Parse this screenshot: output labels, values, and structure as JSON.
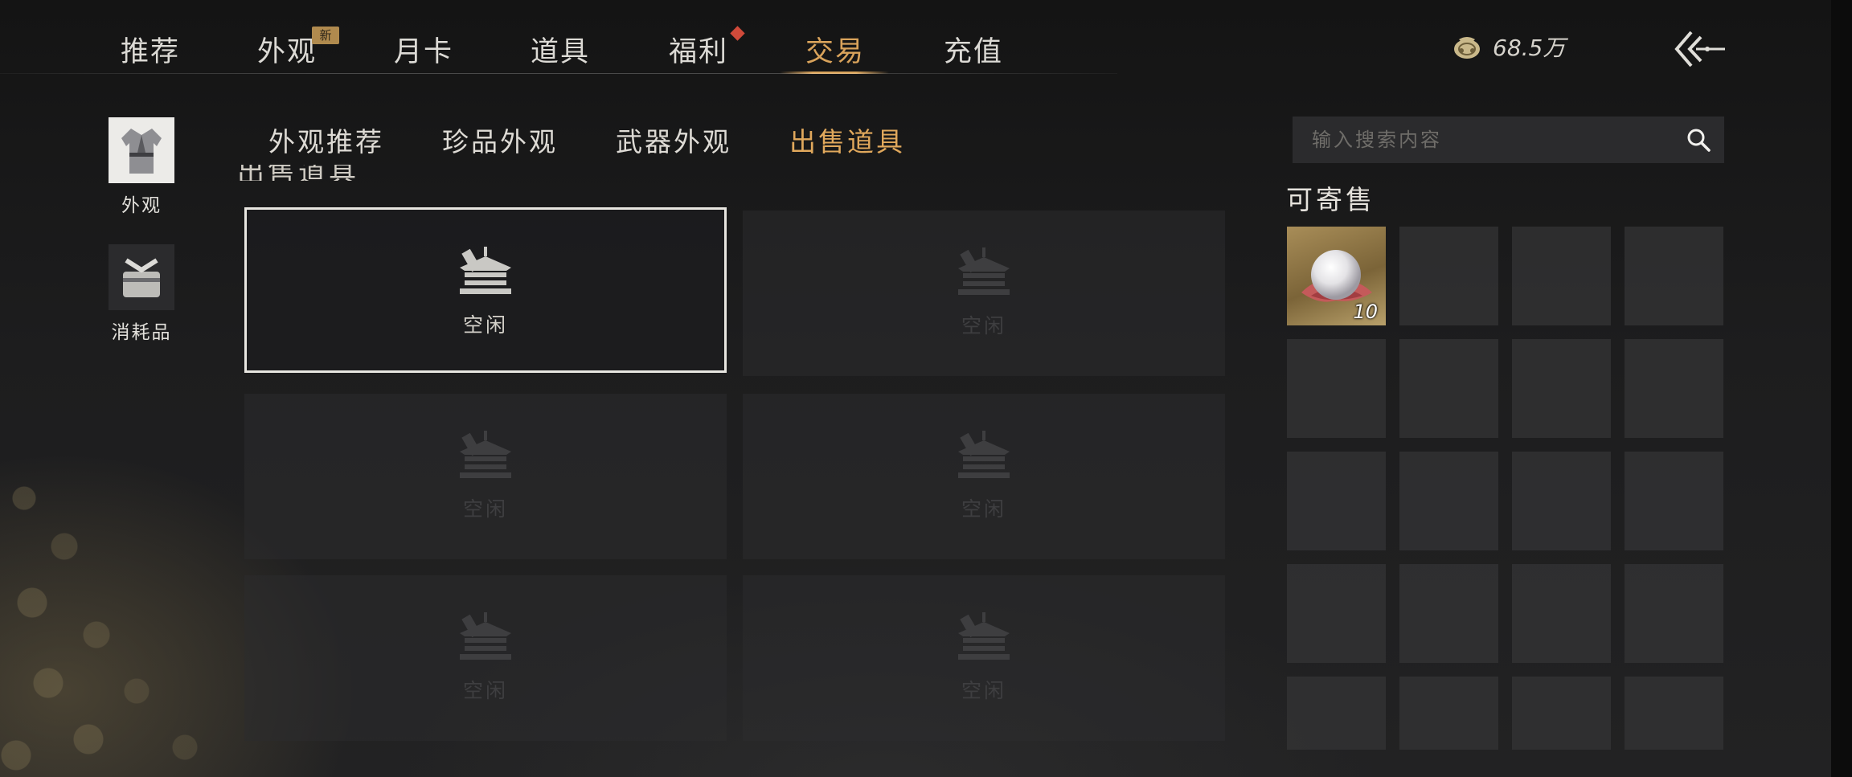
{
  "nav": {
    "tabs": [
      {
        "label": "推荐",
        "active": false
      },
      {
        "label": "外观",
        "active": false,
        "badge": "新"
      },
      {
        "label": "月卡",
        "active": false
      },
      {
        "label": "道具",
        "active": false
      },
      {
        "label": "福利",
        "active": false,
        "has_red_dot": true
      },
      {
        "label": "交易",
        "active": true
      },
      {
        "label": "充值",
        "active": false
      }
    ],
    "currency": {
      "icon": "coin-pouch-icon",
      "amount": "68.5万"
    },
    "back_icon": "double-chevron-left-icon"
  },
  "categories": [
    {
      "label": "外观",
      "icon": "robe-icon",
      "active": true
    },
    {
      "label": "消耗品",
      "icon": "package-icon",
      "active": false
    }
  ],
  "subtabs": [
    {
      "label": "外观推荐",
      "active": false
    },
    {
      "label": "珍品外观",
      "active": false
    },
    {
      "label": "武器外观",
      "active": false
    },
    {
      "label": "出售道具",
      "active": true
    }
  ],
  "listing_header_partial": "出售道具",
  "slots": [
    {
      "label": "空闲",
      "selected": true
    },
    {
      "label": "空闲",
      "selected": false
    },
    {
      "label": "空闲",
      "selected": false
    },
    {
      "label": "空闲",
      "selected": false
    },
    {
      "label": "空闲",
      "selected": false
    },
    {
      "label": "空闲",
      "selected": false
    }
  ],
  "search": {
    "placeholder": "输入搜索内容",
    "value": ""
  },
  "inventory": {
    "title": "可寄售",
    "items": [
      {
        "name": "pearl-icon",
        "count": "10"
      }
    ]
  },
  "colors": {
    "accent": "#d9a35b",
    "red_dot": "#d04a3a",
    "badge_bg": "#b08a4e"
  }
}
